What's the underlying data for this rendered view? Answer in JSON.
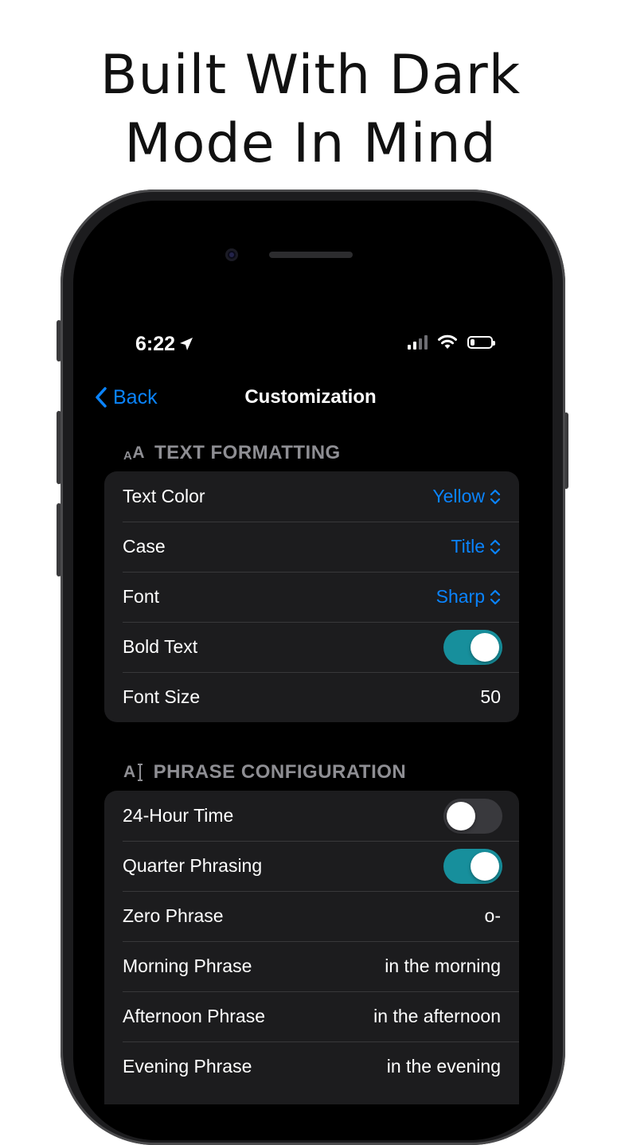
{
  "headline": {
    "line1": "Built With Dark",
    "line2": "Mode In Mind"
  },
  "status_bar": {
    "time": "6:22",
    "icons": [
      "location-arrow-icon",
      "cellular-signal-icon",
      "wifi-icon",
      "battery-icon"
    ],
    "battery_level": 0.2
  },
  "nav": {
    "back_label": "Back",
    "title": "Customization"
  },
  "text_formatting": {
    "header": "TEXT FORMATTING",
    "icon_label": "AA",
    "rows": {
      "text_color": {
        "label": "Text Color",
        "value": "Yellow"
      },
      "case": {
        "label": "Case",
        "value": "Title"
      },
      "font": {
        "label": "Font",
        "value": "Sharp"
      },
      "bold_text": {
        "label": "Bold Text",
        "on": true
      },
      "font_size": {
        "label": "Font Size",
        "value": "50"
      }
    }
  },
  "phrase_configuration": {
    "header": "PHRASE CONFIGURATION",
    "icon_label": "A",
    "rows": {
      "hour24": {
        "label": "24-Hour Time",
        "on": false
      },
      "quarter": {
        "label": "Quarter Phrasing",
        "on": true
      },
      "zero": {
        "label": "Zero Phrase",
        "value": "o-"
      },
      "morning": {
        "label": "Morning Phrase",
        "value": "in the morning"
      },
      "afternoon": {
        "label": "Afternoon Phrase",
        "value": "in the afternoon"
      },
      "evening": {
        "label": "Evening Phrase",
        "value": "in the evening"
      }
    }
  },
  "colors": {
    "accent_blue": "#0a84ff",
    "toggle_on": "#178f9c",
    "toggle_off": "#39393d",
    "cell_bg": "#1c1c1e",
    "screen_bg": "#000000"
  }
}
